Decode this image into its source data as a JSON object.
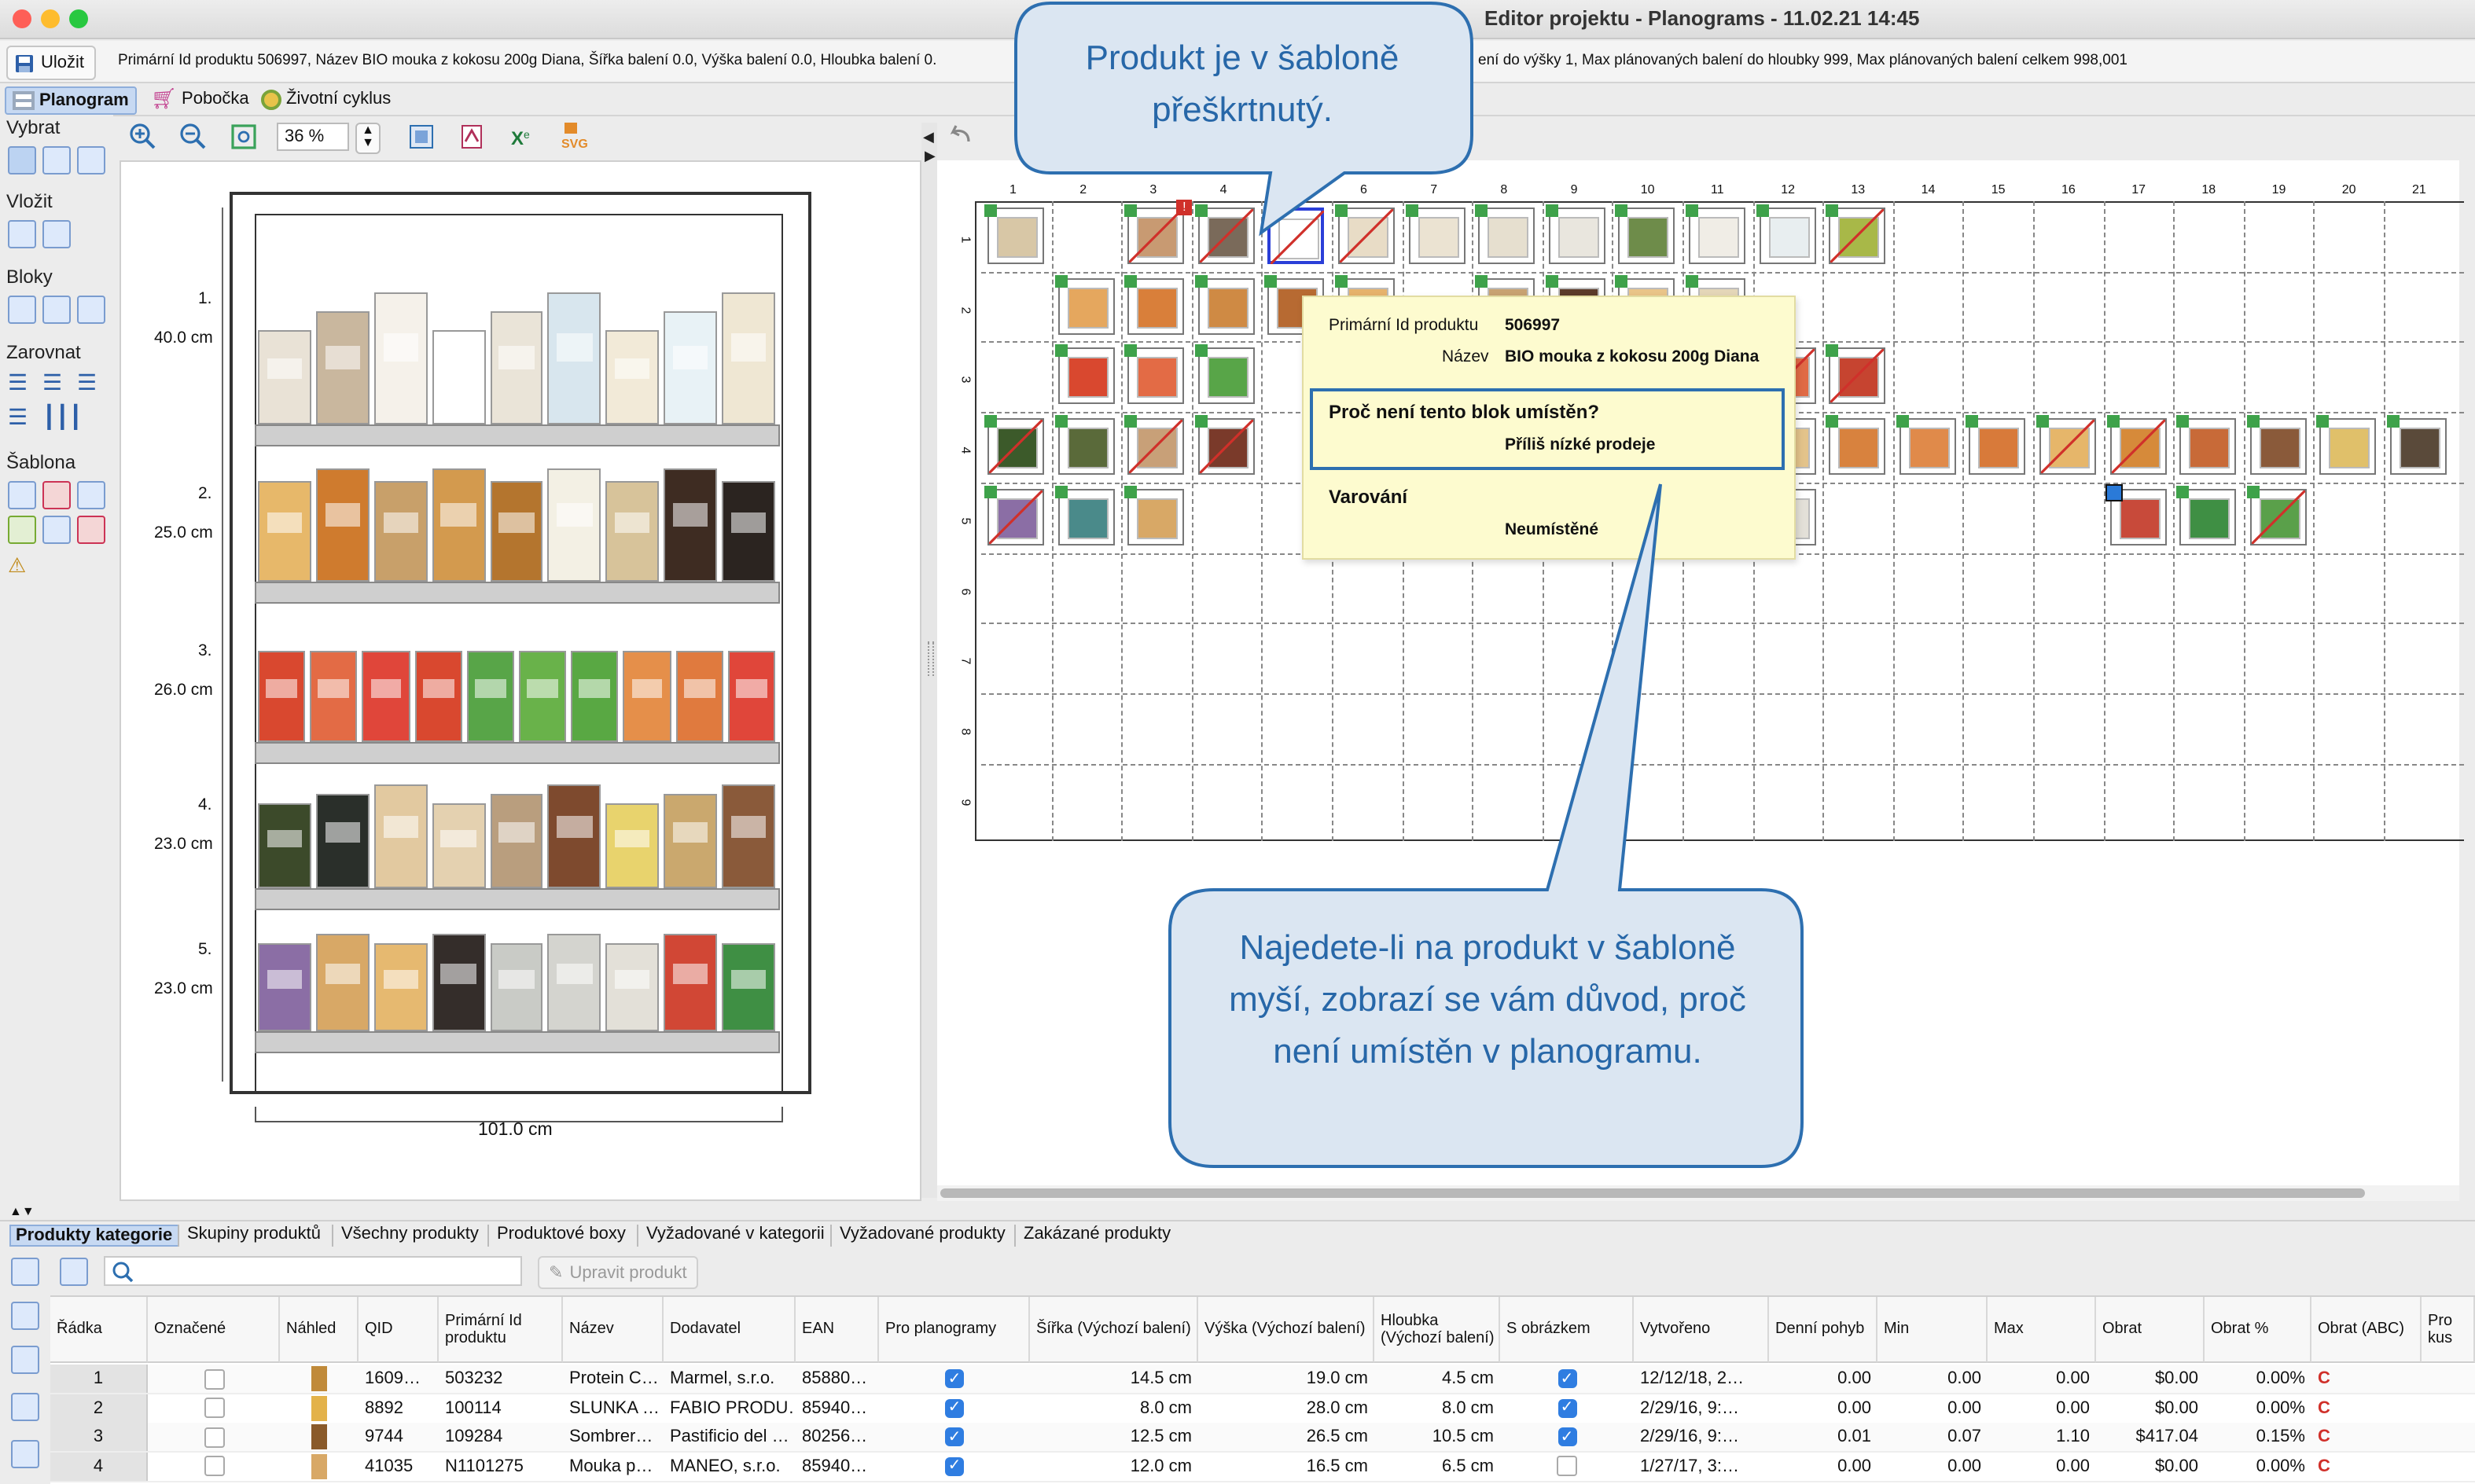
{
  "window": {
    "title": "Editor projektu - Planograms - 11.02.21 14:45"
  },
  "infobar": {
    "save_label": "Uložit",
    "left_text": "Primární Id produktu 506997, Název BIO mouka z kokosu 200g Diana, Šířka balení 0.0, Výška balení 0.0, Hloubka balení 0.",
    "right_text": "ení do výšky 1, Max plánovaných balení do hloubky 999, Max plánovaných balení celkem 998,001"
  },
  "main_tabs": [
    "Planogram",
    "Pobočka",
    "Životní cyklus"
  ],
  "left_groups": [
    "Vybrat",
    "Vložit",
    "Bloky",
    "Zarovnat",
    "Šablona"
  ],
  "zoom": {
    "value": "36 %"
  },
  "shelves": [
    {
      "num": "1.",
      "height": "40.0 cm"
    },
    {
      "num": "2.",
      "height": "25.0 cm"
    },
    {
      "num": "3.",
      "height": "26.0 cm"
    },
    {
      "num": "4.",
      "height": "23.0 cm"
    },
    {
      "num": "5.",
      "height": "23.0 cm"
    }
  ],
  "shelf_width": "101.0 cm",
  "grid": {
    "columns": [
      "1",
      "2",
      "3",
      "4",
      "5",
      "6",
      "7",
      "8",
      "9",
      "10",
      "11",
      "12",
      "13",
      "14",
      "15",
      "16",
      "17",
      "18",
      "19",
      "20",
      "21"
    ],
    "rows": [
      "1",
      "2",
      "3",
      "4",
      "5",
      "6",
      "7",
      "8",
      "9"
    ]
  },
  "tooltip": {
    "id_label": "Primární Id produktu",
    "id_value": "506997",
    "name_label": "Název",
    "name_value": "BIO mouka z kokosu 200g Diana",
    "question": "Proč není tento blok umístěn?",
    "answer": "Příliš nízké prodeje",
    "warning_title": "Varování",
    "warning_value": "Neumístěné"
  },
  "callouts": {
    "top": "Produkt je v šabloně přeškrtnutý.",
    "bottom": "Najedete-li na produkt v šabloně myší, zobrazí se vám důvod, proč není umístěn v planogramu."
  },
  "bottom_tabs": [
    "Produkty kategorie",
    "Skupiny produktů",
    "Všechny produkty",
    "Produktové boxy",
    "Vyžadované v kategorii",
    "Vyžadované produkty",
    "Zakázané produkty"
  ],
  "search": {
    "placeholder": "",
    "edit_button": "Upravit produkt"
  },
  "table": {
    "headers": [
      "Řádka",
      "Označené",
      "Náhled",
      "QID",
      "Primární Id produktu",
      "Název",
      "Dodavatel",
      "EAN",
      "Pro planogramy",
      "Šířka (Výchozí balení)",
      "Výška (Výchozí balení)",
      "Hloubka (Výchozí balení)",
      "S obrázkem",
      "Vytvořeno",
      "Denní pohyb",
      "Min",
      "Max",
      "Obrat",
      "Obrat %",
      "Obrat (ABC)",
      "Pro kus"
    ],
    "rows": [
      {
        "radka": "1",
        "qid": "1609…",
        "pid": "503232",
        "nazev": "Protein C…",
        "dodavatel": "Marmel, s.r.o.",
        "ean": "85880…",
        "sirka": "14.5 cm",
        "vyska": "19.0 cm",
        "hloubka": "4.5 cm",
        "vytvoreno": "12/12/18, 2…",
        "pohyb": "0.00",
        "min": "0.00",
        "max": "0.00",
        "obrat": "$0.00",
        "obrat_pct": "0.00%",
        "abc": "C"
      },
      {
        "radka": "2",
        "qid": "8892",
        "pid": "100114",
        "nazev": "SLUNKA …",
        "dodavatel": "FABIO PRODU…",
        "ean": "85940…",
        "sirka": "8.0 cm",
        "vyska": "28.0 cm",
        "hloubka": "8.0 cm",
        "vytvoreno": "2/29/16, 9:…",
        "pohyb": "0.00",
        "min": "0.00",
        "max": "0.00",
        "obrat": "$0.00",
        "obrat_pct": "0.00%",
        "abc": "C"
      },
      {
        "radka": "3",
        "qid": "9744",
        "pid": "109284",
        "nazev": "Sombrer…",
        "dodavatel": "Pastificio del …",
        "ean": "80256…",
        "sirka": "12.5 cm",
        "vyska": "26.5 cm",
        "hloubka": "10.5 cm",
        "vytvoreno": "2/29/16, 9:…",
        "pohyb": "0.01",
        "min": "0.07",
        "max": "1.10",
        "obrat": "$417.04",
        "obrat_pct": "0.15%",
        "abc": "C"
      },
      {
        "radka": "4",
        "qid": "41035",
        "pid": "N1101275",
        "nazev": "Mouka p…",
        "dodavatel": "MANEO, s.r.o.",
        "ean": "85940…",
        "sirka": "12.0 cm",
        "vyska": "16.5 cm",
        "hloubka": "6.5 cm",
        "vytvoreno": "1/27/17, 3:…",
        "pohyb": "0.00",
        "min": "0.00",
        "max": "0.00",
        "obrat": "$0.00",
        "obrat_pct": "0.00%",
        "abc": "C"
      }
    ]
  },
  "colors": {
    "accent": "#2f7de1",
    "callout_bg": "#dbe6f2",
    "callout_border": "#2d6fb0",
    "tooltip_bg": "#fdfbcf",
    "flag_green": "#3ea24a",
    "cross_red": "#d0302a"
  }
}
